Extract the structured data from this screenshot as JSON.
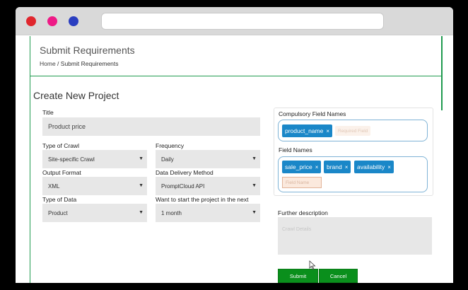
{
  "header": {
    "title": "Submit Requirements",
    "breadcrumb_home": "Home",
    "breadcrumb_sep": " / ",
    "breadcrumb_current": "Submit Requirements"
  },
  "form": {
    "section_title": "Create New Project",
    "title_label": "Title",
    "title_value": "Product price",
    "type_of_crawl_label": "Type of Crawl",
    "type_of_crawl_value": "Site-specific Crawl",
    "frequency_label": "Frequency",
    "frequency_value": "Daily",
    "output_format_label": "Output Format",
    "output_format_value": "XML",
    "delivery_label": "Data Delivery Method",
    "delivery_value": "PromptCloud API",
    "type_of_data_label": "Type of Data",
    "type_of_data_value": "Product",
    "start_label": "Want to start the project in the next",
    "start_value": "1 month"
  },
  "fields_panel": {
    "compulsory_label": "Compulsory Field Names",
    "compulsory_tags": [
      "product_name"
    ],
    "compulsory_placeholder": "Required Field",
    "field_names_label": "Field Names",
    "field_tags": [
      "sale_price",
      "brand",
      "availability"
    ],
    "field_placeholder": "Field Name",
    "remove_symbol": "×"
  },
  "description": {
    "label": "Further description",
    "placeholder": "Crawl Details"
  },
  "buttons": {
    "submit": "Submit",
    "cancel": "Cancel"
  },
  "colors": {
    "accent_green": "#0a8f1c",
    "tag_blue": "#1a87c8",
    "border_green": "#1f9a4e"
  },
  "icons": {
    "dropdown": "triangle-down",
    "cursor": "mouse-pointer"
  }
}
